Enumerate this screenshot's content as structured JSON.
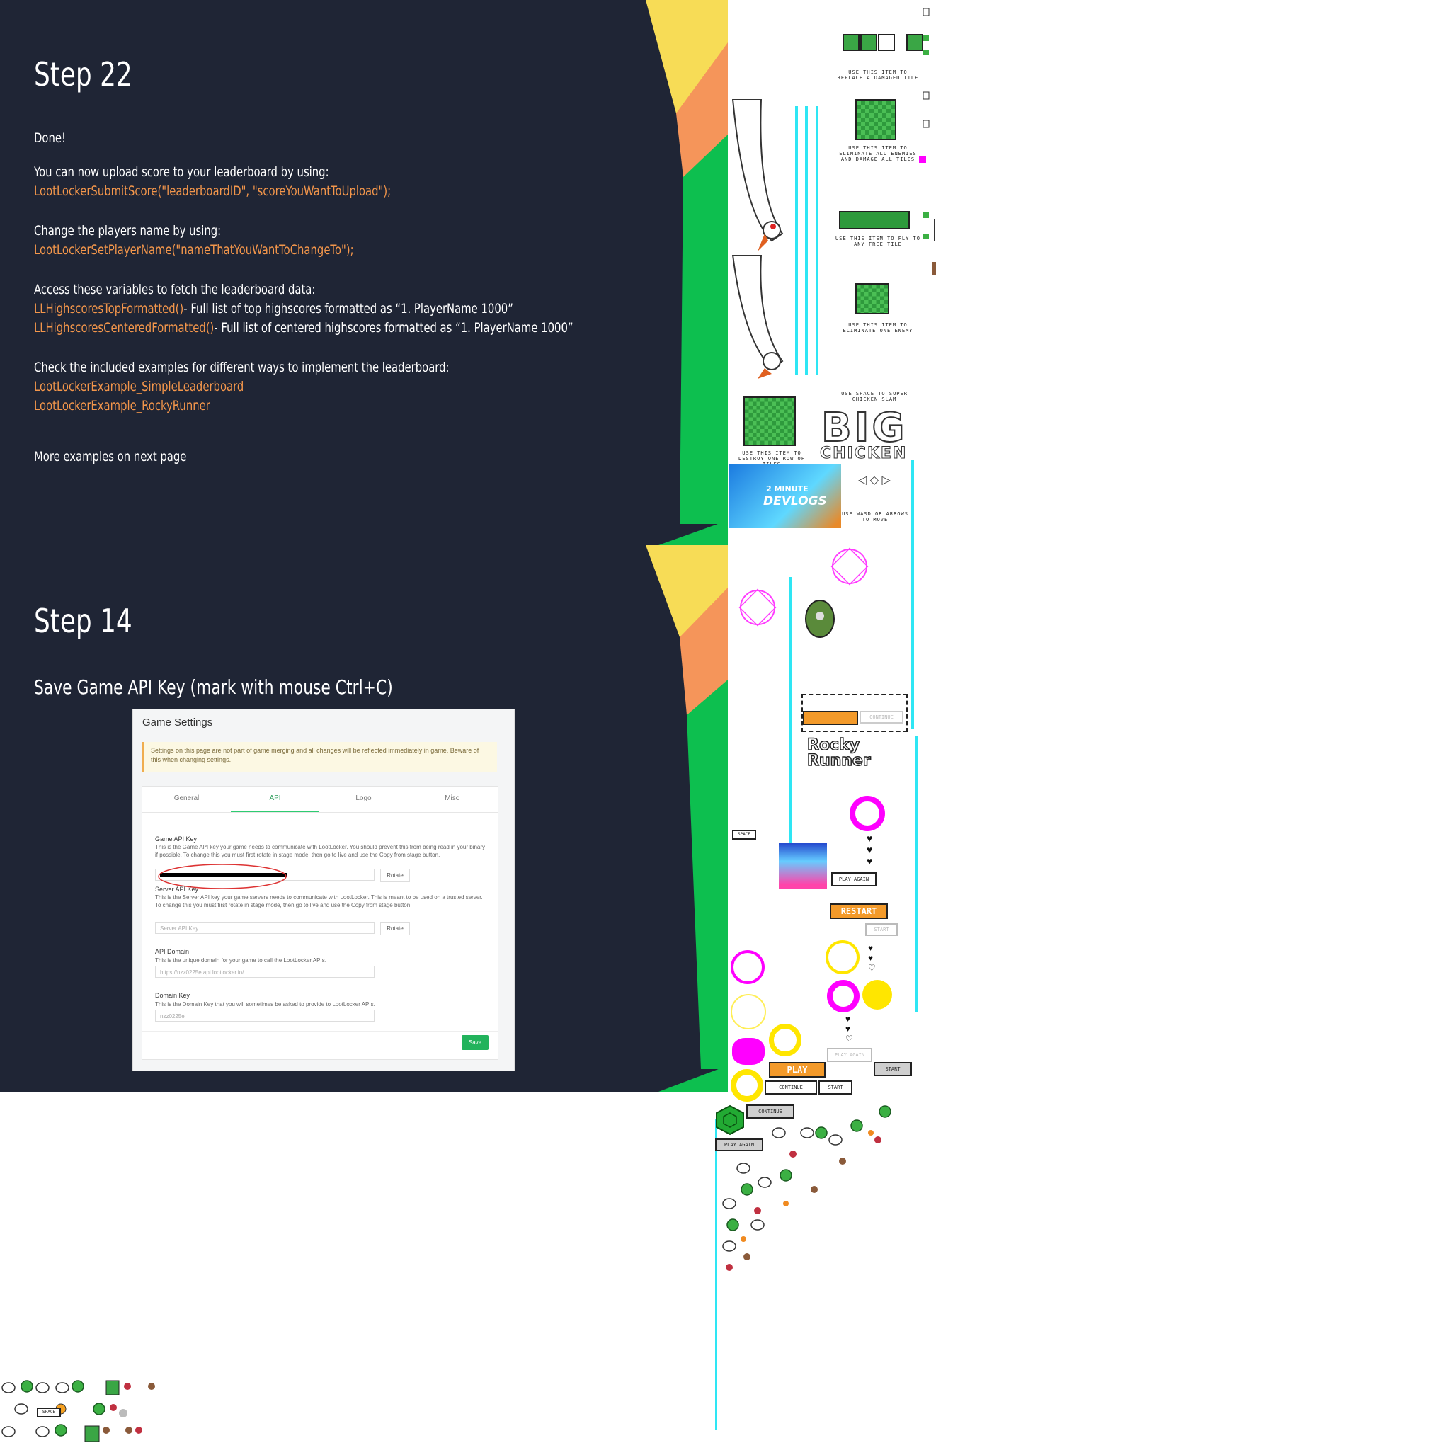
{
  "step22": {
    "title": "Step 22",
    "done": "Done!",
    "upload_intro": "You can now upload score to your leaderboard by using:",
    "upload_code": "LootLockerSubmitScore(\"leaderboardID\", \"scoreYouWantToUpload\");",
    "name_intro": "Change the players name by using:",
    "name_code": "LootLockerSetPlayerName(\"nameThatYouWantToChangeTo\");",
    "vars_intro": "Access these variables to fetch the leaderboard data:",
    "var1_code": "LLHighscoresTopFormatted()",
    "var1_desc": "- Full list of top highscores formatted as “1. PlayerName      1000”",
    "var2_code": "LLHighscoresCenteredFormatted()",
    "var2_desc": "- Full list of centered highscores formatted as “1. PlayerName      1000”",
    "examples_intro": "Check the included examples for different ways to implement the leaderboard:",
    "example1": "LootLockerExample_SimpleLeaderboard",
    "example2": "LootLockerExample_RockyRunner",
    "more": "More examples on next page"
  },
  "step14": {
    "title": "Step 14",
    "subtitle": "Save Game API Key (mark with mouse Ctrl+C)"
  },
  "game_settings": {
    "title": "Game Settings",
    "warning": "Settings on this page are not part of game merging and all changes will be reflected immediately in game. Beware of this when changing settings.",
    "tabs": [
      "General",
      "API",
      "Logo",
      "Misc"
    ],
    "active_tab": "API",
    "game_api_key_label": "Game API Key",
    "game_api_key_desc": "This is the Game API key your game needs to communicate with LootLocker. You should prevent this from being read in your binary if possible. To change this you must first rotate in stage mode, then go to live and use the Copy from stage button.",
    "server_api_key_label": "Server API Key",
    "server_api_key_desc": "This is the Server API key your game servers needs to communicate with LootLocker. This is meant to be used on a trusted server. To change this you must first rotate in stage mode, then go to live and use the Copy from stage button.",
    "server_api_key_placeholder": "Server API Key",
    "rotate_label": "Rotate",
    "api_domain_label": "API Domain",
    "api_domain_desc": "This is the unique domain for your game to call the LootLocker APIs.",
    "api_domain_value": "https://nzz0225e.api.lootlocker.io/",
    "domain_key_label": "Domain Key",
    "domain_key_desc": "This is the Domain Key that you will sometimes be asked to provide to LootLocker APIs.",
    "domain_key_value": "nzz0225e",
    "save_label": "Save"
  },
  "sprites": {
    "tile_hint_1": "USE THIS ITEM TO REPLACE A DAMAGED TILE",
    "tile_hint_2": "USE THIS ITEM TO ELIMINATE ALL ENEMIES AND DAMAGE ALL TILES",
    "tile_hint_3": "USE THIS ITEM TO FLY TO ANY FREE TILE",
    "tile_hint_4": "USE THIS ITEM TO ELIMINATE ONE ENEMY",
    "tile_hint_5": "USE THIS ITEM TO DESTROY ONE ROW OF TILES",
    "space_hint": "USE SPACE TO SUPER CHICKEN SLAM",
    "big_chicken_1": "BIG",
    "big_chicken_2": "CHICKEN",
    "devlogs_1": "2 MINUTE",
    "devlogs_2": "DEVLOGS",
    "move_hint": "USE WASD OR ARROWS TO MOVE",
    "rocky_1": "Rocky",
    "rocky_2": "Runner",
    "play_again": "PLAY AGAIN",
    "restart": "RESTART",
    "start": "START",
    "continue": "CONTINUE",
    "play": "PLAY",
    "space": "SPACE"
  },
  "colors": {
    "panel_bg": "#1f2535",
    "code": "#f3964b",
    "yellow": "#f7dc56",
    "orange": "#f5955a",
    "green": "#0dbf4f",
    "cyan": "#2ee6f4",
    "magenta": "#ff00ff"
  }
}
